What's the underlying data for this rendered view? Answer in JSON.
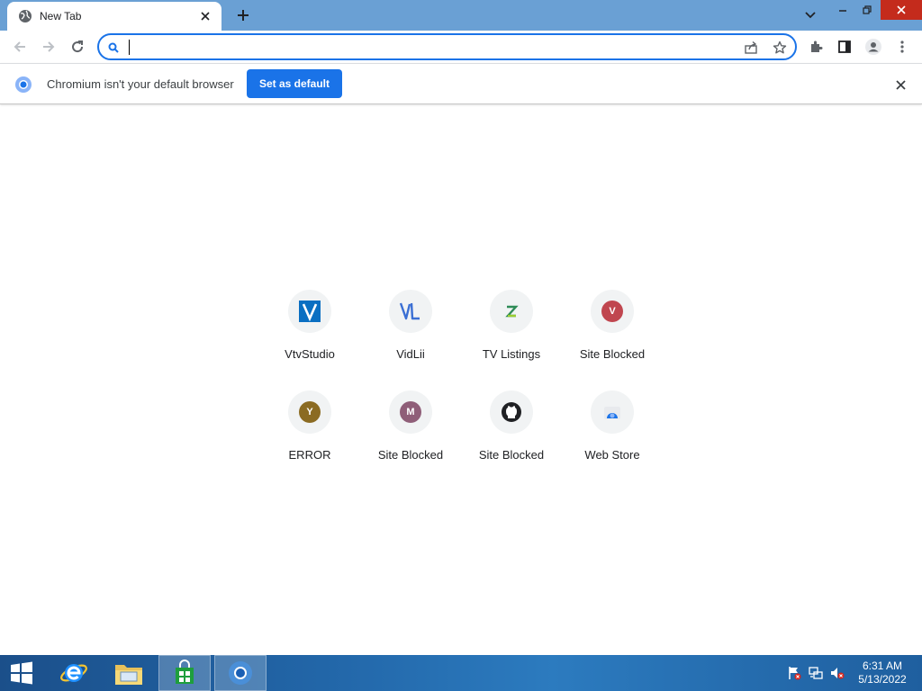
{
  "browser": {
    "tab": {
      "title": "New Tab",
      "favicon": "globe-icon"
    },
    "window_controls": [
      "tab-search-icon",
      "minimize-icon",
      "restore-icon",
      "close-icon"
    ]
  },
  "toolbar": {
    "omnibox": {
      "value": "",
      "placeholder": ""
    }
  },
  "infobar": {
    "message": "Chromium isn't your default browser",
    "button_label": "Set as default"
  },
  "tiles": [
    {
      "label": "VtvStudio",
      "icon": "vtvstudio-icon"
    },
    {
      "label": "VidLii",
      "icon": "vidlii-icon"
    },
    {
      "label": "TV Listings",
      "icon": "tv-listings-icon"
    },
    {
      "label": "Site Blocked",
      "icon": "letter-v-icon",
      "letter": "V",
      "color": "#c0464f"
    },
    {
      "label": "ERROR",
      "icon": "letter-y-icon",
      "letter": "Y",
      "color": "#8b6b22"
    },
    {
      "label": "Site Blocked",
      "icon": "letter-m-icon",
      "letter": "M",
      "color": "#8f5e78"
    },
    {
      "label": "Site Blocked",
      "icon": "github-icon"
    },
    {
      "label": "Web Store",
      "icon": "web-store-icon"
    }
  ],
  "taskbar": {
    "items": [
      "start-icon",
      "internet-explorer-icon",
      "file-explorer-icon",
      "store-icon",
      "chromium-icon"
    ],
    "clock": {
      "time": "6:31 AM",
      "date": "5/13/2022"
    }
  },
  "colors": {
    "accent": "#1a73e8",
    "tabstrip": "#6aa0d4",
    "taskbar": "#2266a8"
  }
}
